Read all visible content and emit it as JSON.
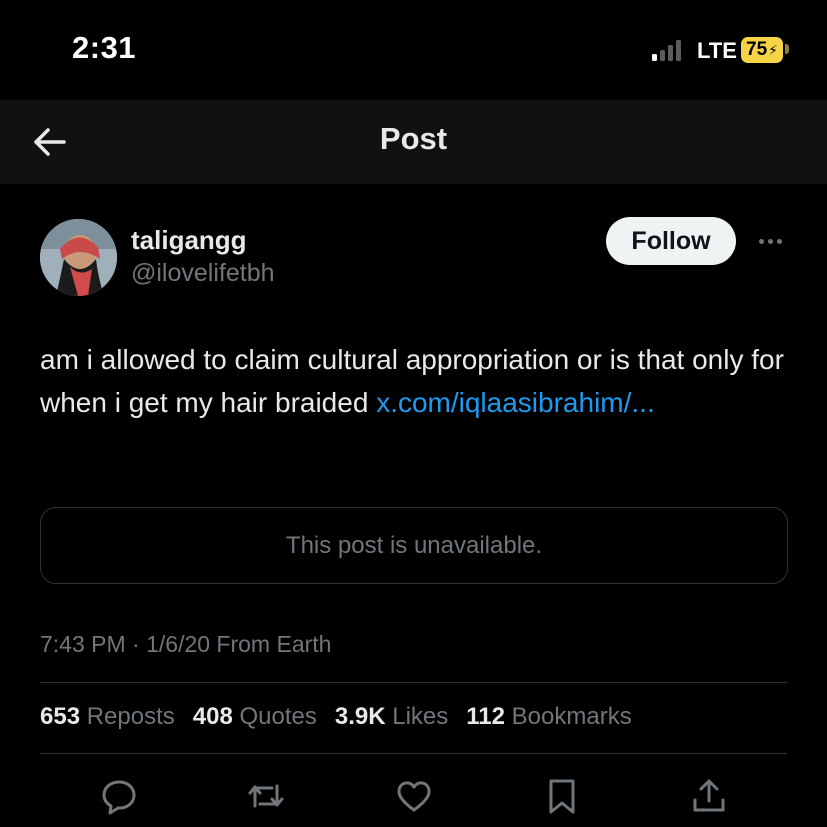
{
  "status_bar": {
    "time": "2:31",
    "network": "LTE",
    "battery": "75",
    "battery_color": "#f5d547"
  },
  "header": {
    "title": "Post",
    "back_icon": "arrow-left-icon"
  },
  "post": {
    "author": {
      "display_name": "taligangg",
      "handle": "@ilovelifetbh"
    },
    "follow_label": "Follow",
    "text": "am i allowed to claim cultural appropriation or is that only for when i get my hair braided ",
    "link": "x.com/iqlaasibrahim/...",
    "quoted_unavailable": "This post is unavailable.",
    "timestamp": "7:43 PM · 1/6/20 From Earth",
    "stats": [
      {
        "value": "653",
        "label": "Reposts"
      },
      {
        "value": "408",
        "label": "Quotes"
      },
      {
        "value": "3.9K",
        "label": "Likes"
      },
      {
        "value": "112",
        "label": "Bookmarks"
      }
    ]
  },
  "actions": [
    "reply-icon",
    "repost-icon",
    "like-icon",
    "bookmark-icon",
    "share-icon"
  ],
  "colors": {
    "background": "#000000",
    "link": "#1d9bf0",
    "muted": "#71767b"
  }
}
